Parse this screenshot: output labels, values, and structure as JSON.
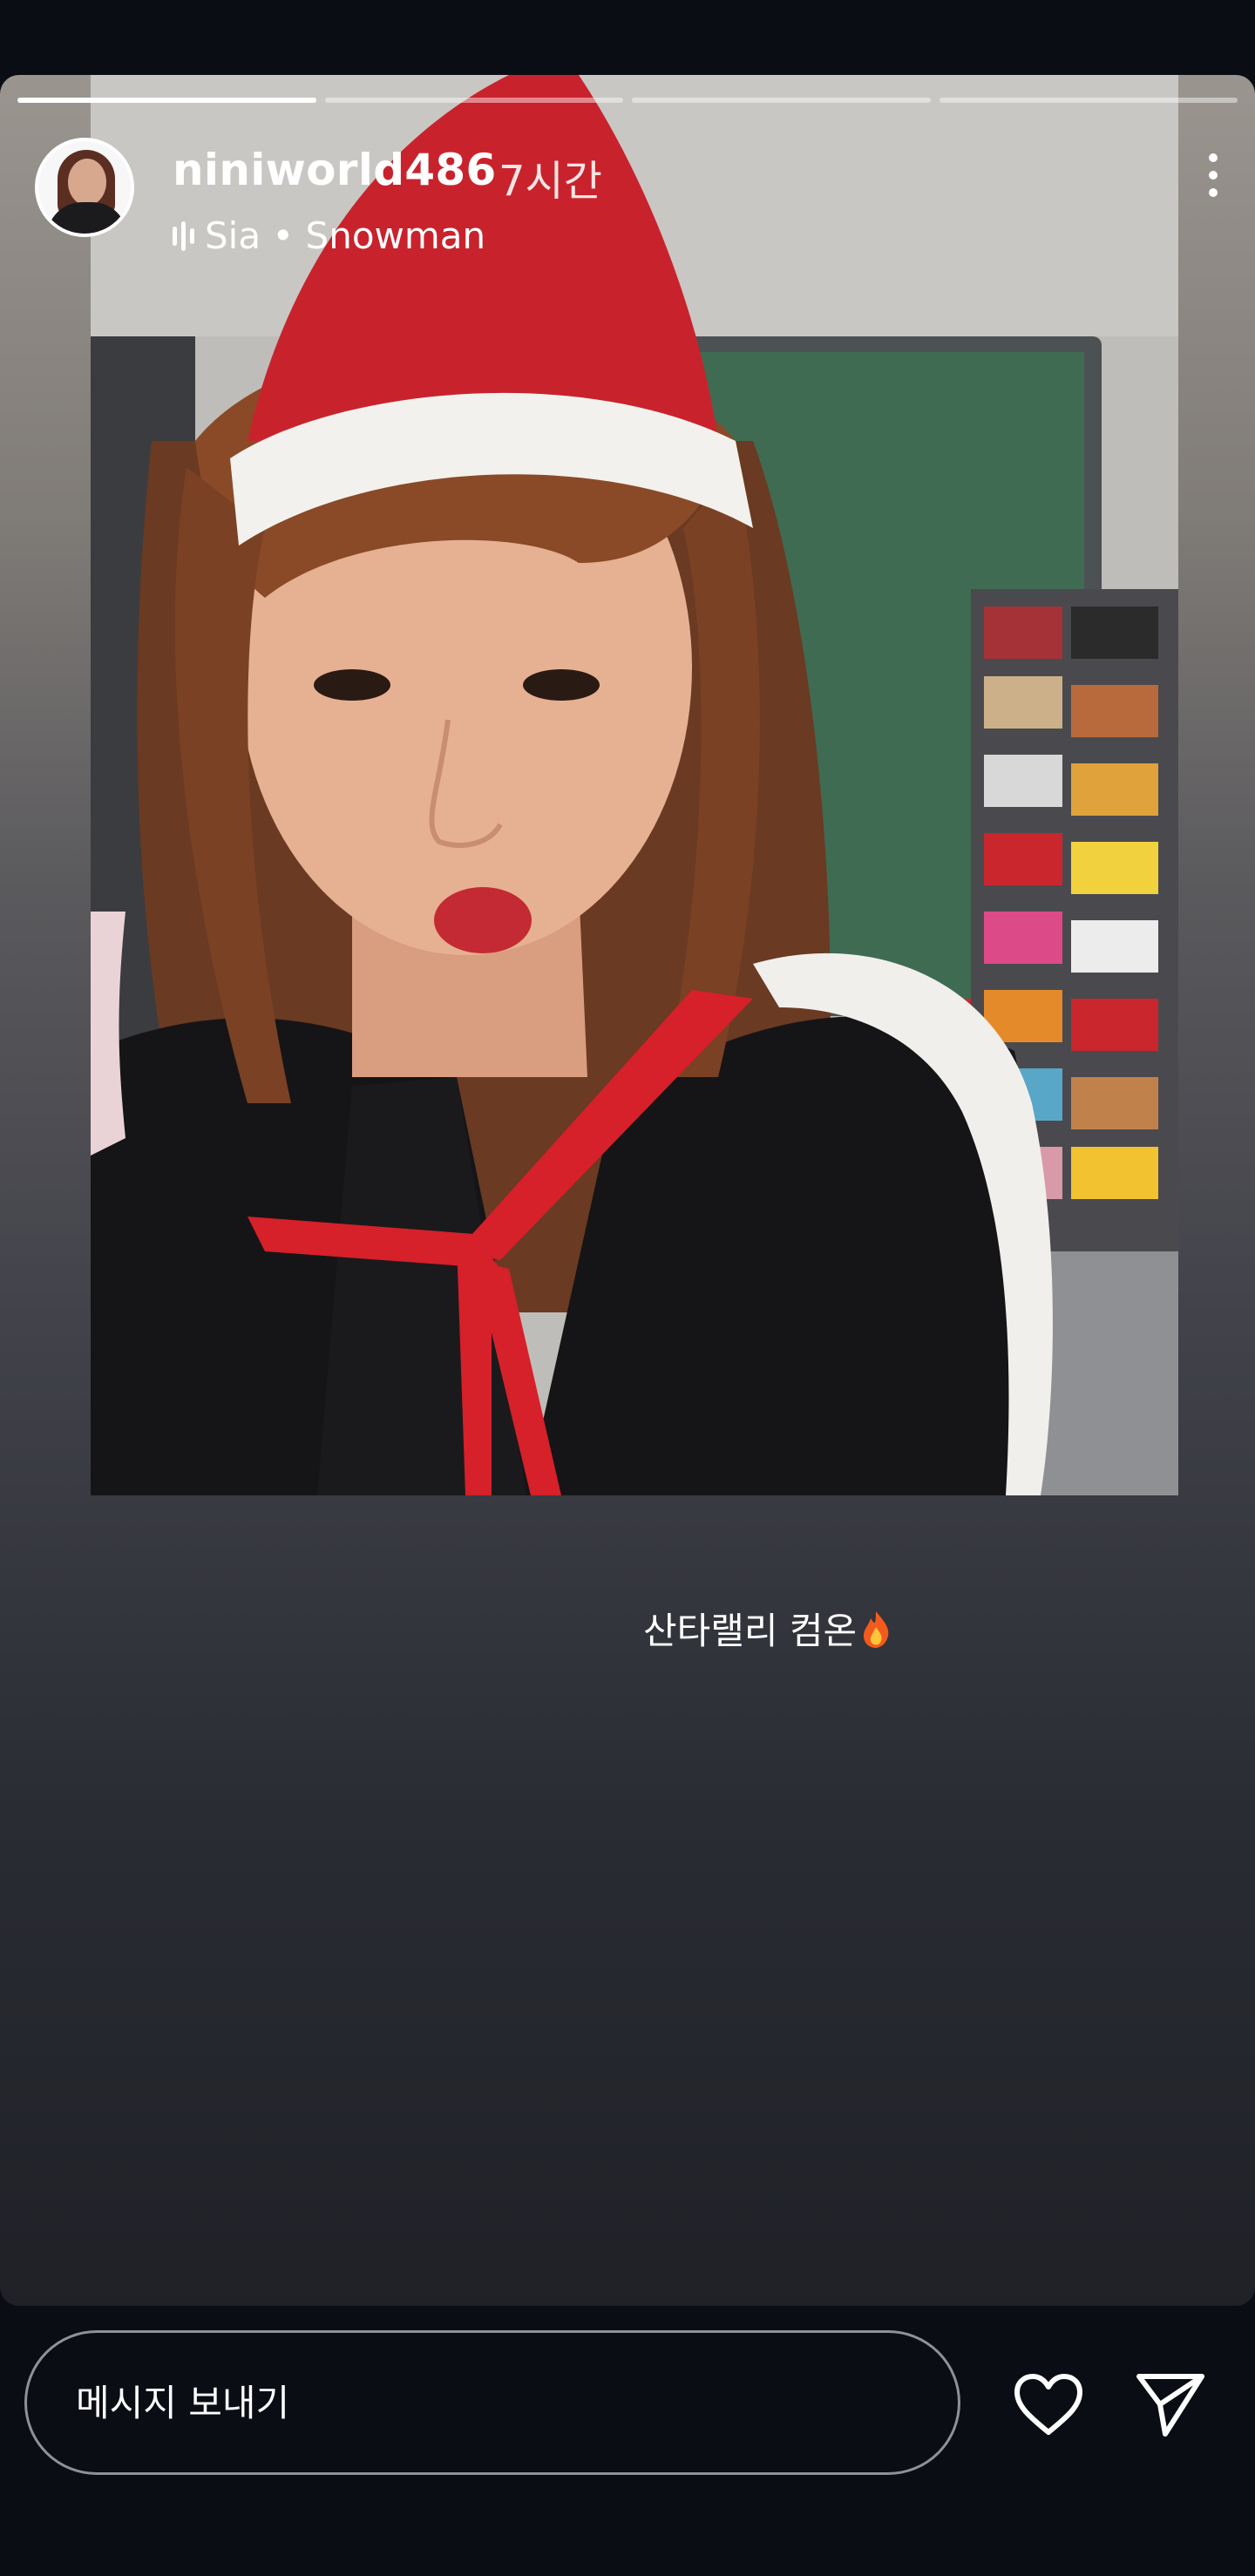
{
  "story": {
    "progress_segments": 4,
    "active_segment": 2,
    "user": {
      "username": "niniworld486",
      "time_ago": "7시간"
    },
    "music": {
      "icon": "audio-waveform-icon",
      "text": "Sia • Snowman"
    },
    "menu_icon": "more-vertical-icon",
    "photo": {
      "description_icon": "story-photo"
    },
    "caption": {
      "text": "산타랠리 컴온",
      "emoji_icon": "fire-emoji-icon"
    }
  },
  "reply_bar": {
    "placeholder": "메시지 보내기",
    "like_icon": "heart-icon",
    "share_icon": "send-icon"
  },
  "colors": {
    "background": "#0a0d14",
    "text": "#ffffff",
    "progress_active": "#ffffff",
    "progress_inactive": "#9a9a9a"
  }
}
